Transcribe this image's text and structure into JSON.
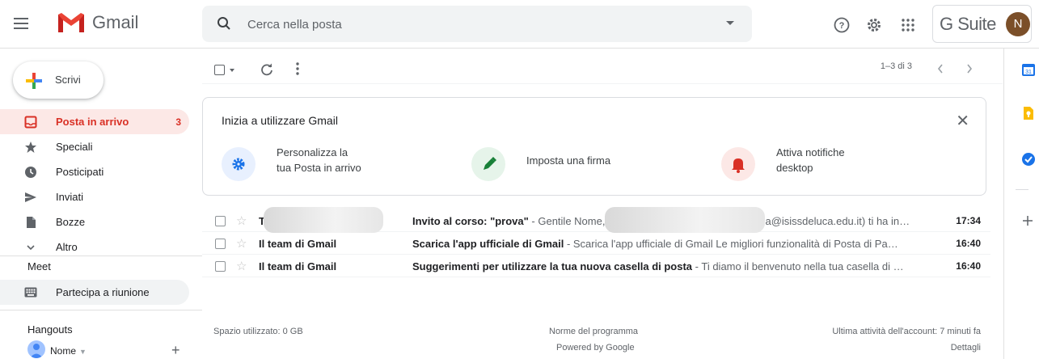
{
  "app": {
    "name": "Gmail"
  },
  "search": {
    "placeholder": "Cerca nella posta"
  },
  "header": {
    "gsuite": "G Suite",
    "avatar_letter": "N",
    "help_icon": "help-icon",
    "settings_icon": "gear-icon",
    "apps_icon": "apps-grid-icon"
  },
  "compose": {
    "label": "Scrivi"
  },
  "sidebar": {
    "items": [
      {
        "label": "Posta in arrivo",
        "count": "3",
        "icon": "inbox-icon",
        "active": true
      },
      {
        "label": "Speciali",
        "icon": "star-icon"
      },
      {
        "label": "Posticipati",
        "icon": "clock-icon"
      },
      {
        "label": "Inviati",
        "icon": "send-icon"
      },
      {
        "label": "Bozze",
        "icon": "draft-icon"
      },
      {
        "label": "Altro",
        "icon": "chevron-down-icon"
      }
    ],
    "meet_title": "Meet",
    "meet_item": "Partecipa a riunione",
    "hangouts_title": "Hangouts",
    "hangouts_user": "Nome"
  },
  "toolbar": {
    "pager": "1–3 di 3"
  },
  "card": {
    "title": "Inizia a utilizzare Gmail",
    "features": [
      {
        "line1": "Personalizza la",
        "line2": "tua Posta in arrivo",
        "icon": "settings-icon",
        "color": "#1a73e8",
        "bg": "#e8f0fe"
      },
      {
        "line1": "Imposta una firma",
        "line2": "",
        "icon": "pen-icon",
        "color": "#188038",
        "bg": "#e6f4ea"
      },
      {
        "line1": "Attiva notifiche",
        "line2": "desktop",
        "icon": "bell-icon",
        "color": "#d93025",
        "bg": "#fce8e6"
      }
    ]
  },
  "emails": [
    {
      "sender": "T",
      "subject": "Invito al corso: \"prova\"",
      "snippet": " - Gentile Nome,",
      "snippet2": "a@isissdeluca.edu.it) ti ha in…",
      "time": "17:34"
    },
    {
      "sender": "Il team di Gmail",
      "subject": "Scarica l'app ufficiale di Gmail",
      "snippet": " - Scarica l'app ufficiale di Gmail Le migliori funzionalità di Posta di Pa…",
      "time": "16:40"
    },
    {
      "sender": "Il team di Gmail",
      "subject": "Suggerimenti per utilizzare la tua nuova casella di posta",
      "snippet": " - Ti diamo il benvenuto nella tua casella di …",
      "time": "16:40"
    }
  ],
  "footer": {
    "storage": "Spazio utilizzato: 0 GB",
    "policy": "Norme del programma",
    "powered": "Powered by Google",
    "activity": "Ultima attività dell'account: 7 minuti fa",
    "details": "Dettagli"
  },
  "colors": {
    "accent": "#d93025",
    "calendar": "#1a73e8",
    "keep": "#fbbc04",
    "tasks": "#1a73e8"
  }
}
